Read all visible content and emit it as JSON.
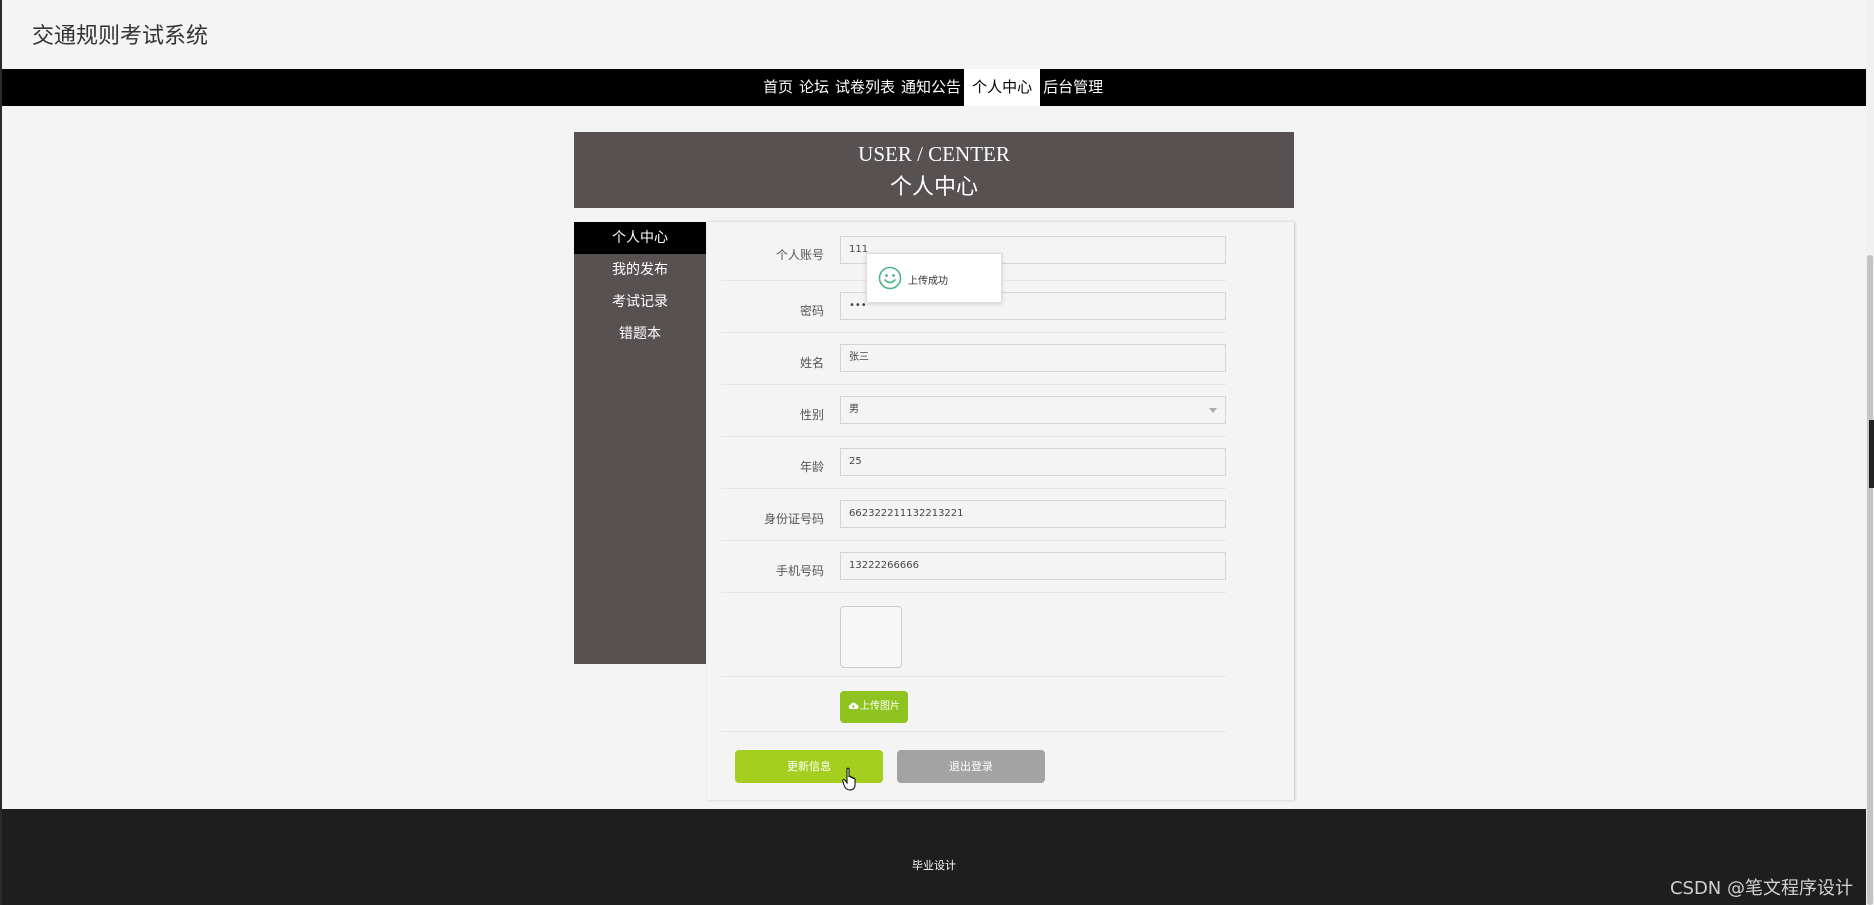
{
  "header": {
    "site_title": "交通规则考试系统"
  },
  "nav": [
    {
      "label": "首页",
      "active": false
    },
    {
      "label": "论坛",
      "active": false
    },
    {
      "label": "试卷列表",
      "active": false
    },
    {
      "label": "通知公告",
      "active": false
    },
    {
      "label": "个人中心",
      "active": true
    },
    {
      "label": "后台管理",
      "active": false
    }
  ],
  "page_header": {
    "en": "USER / CENTER",
    "cn": "个人中心"
  },
  "sidebar": [
    {
      "label": "个人中心",
      "active": true
    },
    {
      "label": "我的发布",
      "active": false
    },
    {
      "label": "考试记录",
      "active": false
    },
    {
      "label": "错题本",
      "active": false
    }
  ],
  "form": {
    "account": {
      "label": "个人账号",
      "value": "111"
    },
    "password": {
      "label": "密码",
      "value": "•••"
    },
    "name": {
      "label": "姓名",
      "value": "张三"
    },
    "gender": {
      "label": "性别",
      "value": "男"
    },
    "age": {
      "label": "年龄",
      "value": "25"
    },
    "id_number": {
      "label": "身份证号码",
      "value": "662322211132213221"
    },
    "phone": {
      "label": "手机号码",
      "value": "13222266666"
    }
  },
  "upload_button": "上传图片",
  "buttons": {
    "update": "更新信息",
    "logout": "退出登录"
  },
  "toast": {
    "text": "上传成功",
    "icon": "smiley-icon",
    "color": "#4db38a"
  },
  "footer": {
    "text": "毕业设计"
  },
  "watermark": "CSDN @笔文程序设计",
  "colors": {
    "accent": "#a5cf1f",
    "header_bg": "#575151",
    "nav_bg": "#000000",
    "footer_bg": "#1e1e1e"
  }
}
